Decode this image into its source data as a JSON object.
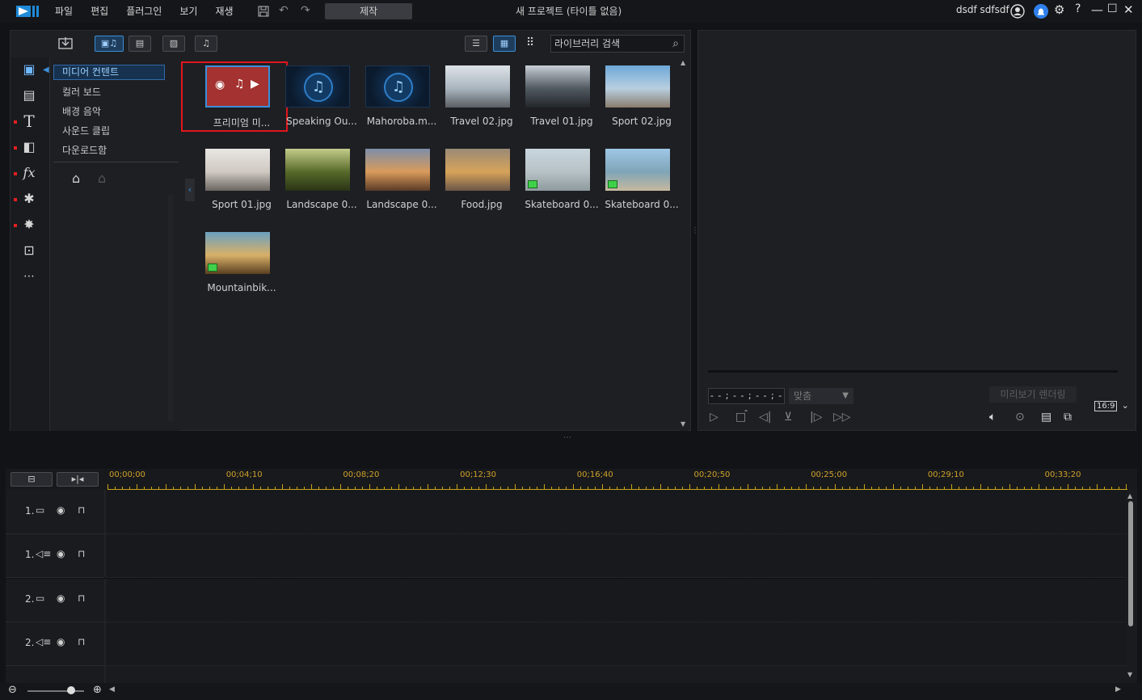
{
  "titlebar": {
    "menu": [
      "파일",
      "편집",
      "플러그인",
      "보기",
      "재생"
    ],
    "produce": "제작",
    "project_title": "새 프로젝트 (타이틀 없음)",
    "user": "dsdf sdfsdf",
    "help": "?"
  },
  "library": {
    "search_placeholder": "라이브러리 검색",
    "categories": [
      "미디어 컨텐트",
      "컬러 보드",
      "배경 음악",
      "사운드 클립",
      "다운로드함"
    ],
    "media": [
      {
        "caption": "프리미엄 미...",
        "kind": "premium"
      },
      {
        "caption": "Speaking Ou...",
        "kind": "music"
      },
      {
        "caption": "Mahoroba.m...",
        "kind": "music"
      },
      {
        "caption": "Travel 02.jpg",
        "kind": "photo",
        "colors": [
          "#dde3e8",
          "#a9b5be",
          "#5a5f63"
        ]
      },
      {
        "caption": "Travel 01.jpg",
        "kind": "photo",
        "colors": [
          "#c8cfd6",
          "#505860",
          "#23272b"
        ]
      },
      {
        "caption": "Sport 02.jpg",
        "kind": "photo",
        "colors": [
          "#6fa8d8",
          "#b8cfe0",
          "#8a7c6e"
        ]
      },
      {
        "caption": "Sport 01.jpg",
        "kind": "photo",
        "colors": [
          "#e9e6e2",
          "#cfc9c2",
          "#6a6560"
        ]
      },
      {
        "caption": "Landscape 0...",
        "kind": "photo",
        "colors": [
          "#c4cc8a",
          "#586a2a",
          "#2a3316"
        ]
      },
      {
        "caption": "Landscape 0...",
        "kind": "photo",
        "colors": [
          "#7d8ea8",
          "#d99b5c",
          "#5a3a26"
        ]
      },
      {
        "caption": "Food.jpg",
        "kind": "photo",
        "colors": [
          "#9a8a76",
          "#d7a35a",
          "#6b5648"
        ]
      },
      {
        "caption": "Skateboard 0...",
        "kind": "video",
        "colors": [
          "#c9d6de",
          "#b7c2c6",
          "#8f9a9e"
        ]
      },
      {
        "caption": "Skateboard 0...",
        "kind": "video",
        "colors": [
          "#9fc7e6",
          "#7fa5b8",
          "#c7b89e"
        ]
      },
      {
        "caption": "Mountainbik...",
        "kind": "video",
        "colors": [
          "#6aa0c0",
          "#d8b068",
          "#5a4020"
        ]
      }
    ]
  },
  "preview": {
    "timecode": "- - ; - - ; - - ; - -",
    "fit": "맞춤",
    "render": "미리보기 렌더링",
    "aspect": "16:9"
  },
  "timeline": {
    "ticks": [
      "00;00;00",
      "00;04;10",
      "00;08;20",
      "00;12;30",
      "00;16;40",
      "00;20;50",
      "00;25;00",
      "00;29;10",
      "00;33;20"
    ],
    "tracks": [
      {
        "label": "1.",
        "type": "video"
      },
      {
        "label": "1.",
        "type": "audio"
      },
      {
        "label": "2.",
        "type": "video"
      },
      {
        "label": "2.",
        "type": "audio"
      }
    ]
  },
  "colors": {
    "accent": "#3b8fd9",
    "highlight": "#e0161c",
    "ruler": "#c8a418"
  }
}
